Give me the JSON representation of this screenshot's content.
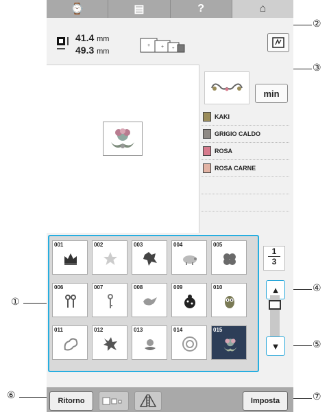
{
  "top_buttons": [
    {
      "name": "clock-button",
      "glyph": "⌚"
    },
    {
      "name": "document-button",
      "glyph": "▤"
    },
    {
      "name": "help-button",
      "glyph": "?"
    },
    {
      "name": "home-button",
      "glyph": "⌂"
    }
  ],
  "dims": {
    "width": "41.4",
    "height": "49.3",
    "unit": "mm"
  },
  "min_label": "min",
  "colors": [
    {
      "name": "KAKI",
      "color": "#9a8c5a"
    },
    {
      "name": "GRIGIO CALDO",
      "color": "#8f8a85"
    },
    {
      "name": "ROSA",
      "color": "#d77b8d"
    },
    {
      "name": "ROSA CARNE",
      "color": "#e2b3a4"
    }
  ],
  "patterns": [
    "001",
    "002",
    "003",
    "004",
    "005",
    "006",
    "007",
    "008",
    "009",
    "010",
    "011",
    "012",
    "013",
    "014",
    "015"
  ],
  "selected_pattern": "015",
  "page": {
    "current": "1",
    "total": "3"
  },
  "scroll": {
    "up": "▲",
    "down": "▼"
  },
  "bottom": {
    "return_label": "Ritorno",
    "set_label": "Imposta"
  },
  "callouts": [
    "①",
    "②",
    "③",
    "④",
    "⑤",
    "⑥",
    "⑦"
  ]
}
